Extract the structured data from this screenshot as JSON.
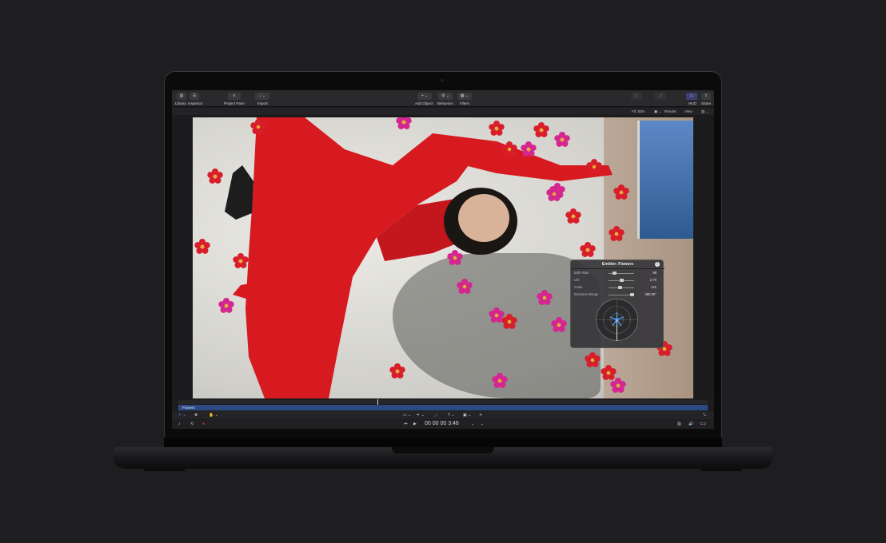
{
  "toolbar": {
    "library_label": "Library",
    "inspector_label": "Inspector",
    "project_pane_label": "Project Pane",
    "import_label": "Import",
    "add_object_label": "Add Object",
    "behaviors_label": "Behaviors",
    "filters_label": "Filters",
    "hud_label": "HUD",
    "share_label": "Share"
  },
  "view_bar": {
    "fit": "Fit: 83%",
    "render": "Render",
    "view": "View"
  },
  "hud": {
    "title": "Emitter: Flowers",
    "params": [
      {
        "label": "Birth Rate",
        "value": "88",
        "level": 0.2
      },
      {
        "label": "Life",
        "value": "2.70",
        "level": 0.5
      },
      {
        "label": "Scale",
        "value": "121",
        "level": 0.45
      },
      {
        "label": "Emission Range",
        "value": "360.00°",
        "level": 1.0
      }
    ]
  },
  "timeline": {
    "track_name": "Flowers",
    "timecode": "00 00 00 3:46"
  },
  "colors": {
    "accent": "#2b4a83",
    "flower_red": "#d81e2a",
    "flower_magenta": "#d4268f",
    "dress_red": "#d71920"
  }
}
